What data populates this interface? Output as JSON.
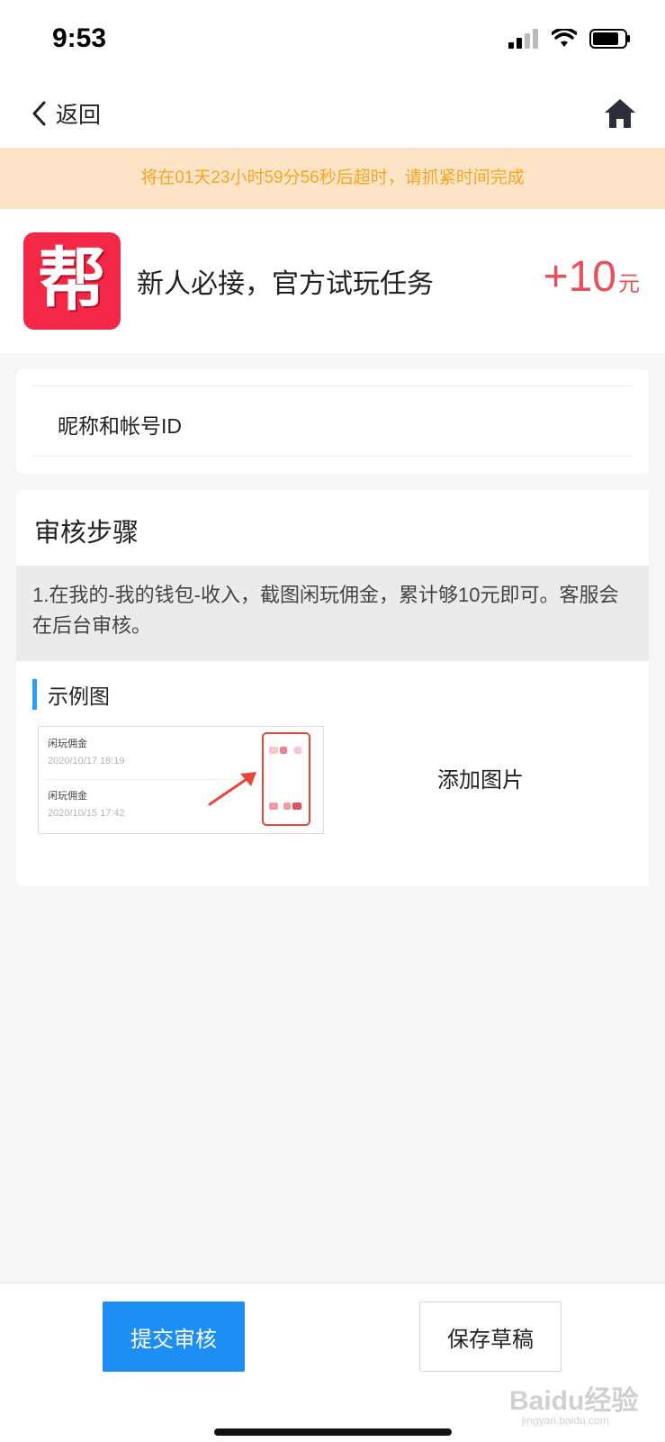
{
  "status_bar": {
    "time": "9:53"
  },
  "nav": {
    "back_label": "返回"
  },
  "countdown": {
    "text": "将在01天23小时59分56秒后超时，请抓紧时间完成"
  },
  "task": {
    "logo_char": "帮",
    "title": "新人必接，官方试玩任务",
    "reward_amount": "+10",
    "reward_unit": "元"
  },
  "nickname": {
    "label": "昵称和帐号ID"
  },
  "steps": {
    "title": "审核步骤",
    "description": "1.在我的-我的钱包-收入，截图闲玩佣金，累计够10元即可。客服会在后台审核。"
  },
  "example": {
    "label": "示例图",
    "rows": [
      {
        "title": "闲玩佣金",
        "date": "2020/10/17 18:19"
      },
      {
        "title": "闲玩佣金",
        "date": "2020/10/15 17:42"
      }
    ],
    "add_image_label": "添加图片"
  },
  "actions": {
    "submit_label": "提交审核",
    "save_draft_label": "保存草稿"
  },
  "watermark": {
    "brand": "Baidu经验",
    "url": "jingyan.baidu.com"
  },
  "colors": {
    "accent": "#1e8ff2",
    "warning_bg": "#fde4c6",
    "warning_text": "#f5a623",
    "reward": "#e8505b",
    "logo_bg": "#f22846"
  }
}
